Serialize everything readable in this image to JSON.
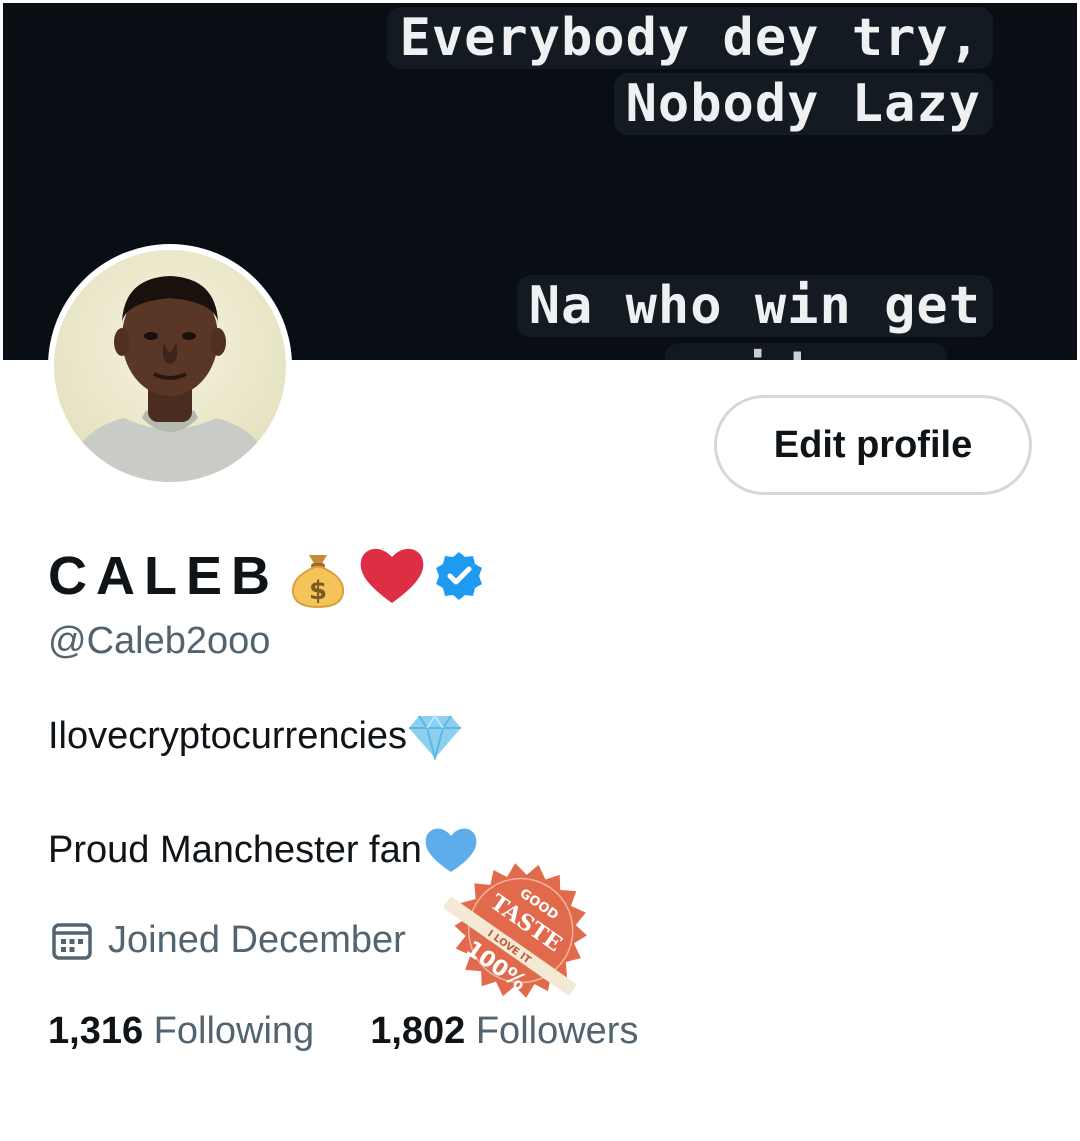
{
  "banner": {
    "lines": [
      "Everybody dey try,",
      "Nobody Lazy",
      "Na who win get",
      "evidence"
    ]
  },
  "profile": {
    "name": "CALEB",
    "handle": "@Caleb2ooo",
    "bio_line1": "Ilovecryptocurrencies",
    "bio_line2": "Proud Manchester fan",
    "joined": "Joined December",
    "verified": true
  },
  "actions": {
    "edit_profile": "Edit profile"
  },
  "stats": {
    "following_count": "1,316",
    "following_label": "Following",
    "followers_count": "1,802",
    "followers_label": "Followers"
  },
  "icons": {
    "name_emojis": [
      "money-bag-icon",
      "red-heart-icon",
      "verified-badge-icon"
    ],
    "bio_line1_emoji": "gem-icon",
    "bio_line2_emoji": "blue-heart-icon",
    "joined_icon": "calendar-icon"
  },
  "sticker": {
    "top": "GOOD",
    "middle": "TASTE",
    "ribbon": "I LOVE IT",
    "bottom": "100%"
  },
  "colors": {
    "text_primary": "#0f1419",
    "text_secondary": "#536471",
    "verified_blue": "#1d9bf0",
    "button_border": "#cfd9de",
    "banner_bg": "#090d14"
  }
}
